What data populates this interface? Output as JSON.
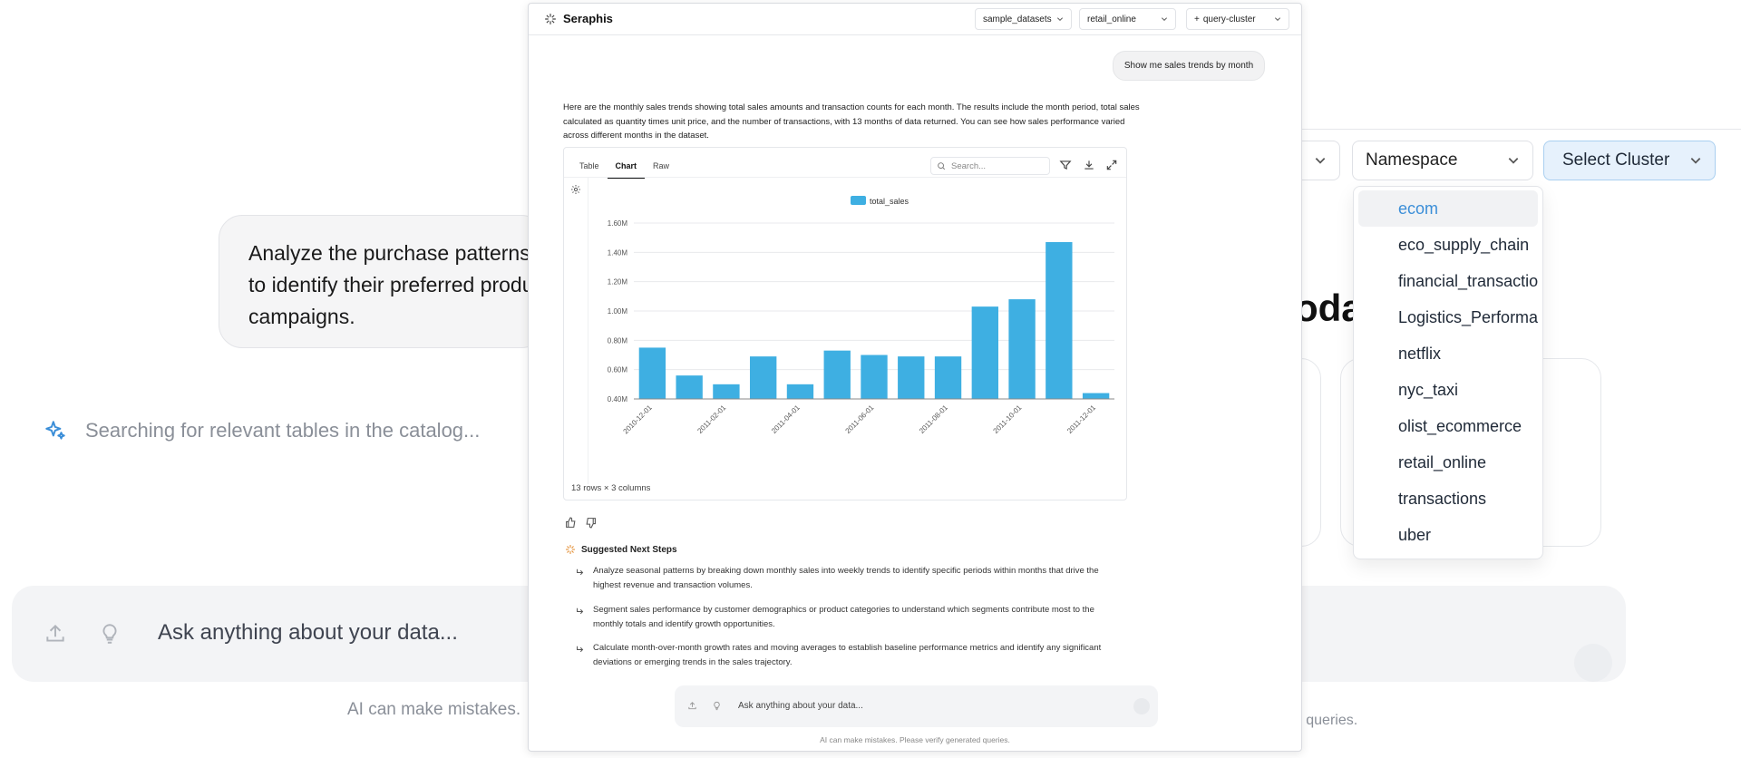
{
  "background": {
    "prompt_bubble_lines": [
      "Analyze the purchase patterns",
      "to identify their preferred produ",
      "campaigns."
    ],
    "searching_text": "Searching for relevant tables in the catalog...",
    "input_placeholder": "Ask anything about your data...",
    "disclaimer_left": "AI can make mistakes.",
    "disclaimer_right": "ed queries.",
    "heading_fragment": "oda",
    "namespace_label": "Namespace",
    "cluster_label": "Select Cluster",
    "dropdown": {
      "selected": "ecom",
      "items": [
        "ecom",
        "eco_supply_chain",
        "financial_transactions",
        "Logistics_Performance",
        "netflix",
        "nyc_taxi",
        "olist_ecommerce",
        "retail_online",
        "transactions",
        "uber"
      ]
    }
  },
  "window": {
    "brand": "Seraphis",
    "selectors": {
      "dataset": "sample_datasets",
      "namespace": "retail_online",
      "cluster": "query-cluster"
    },
    "user_message": "Show me sales trends by month",
    "answer": "Here are the monthly sales trends showing total sales amounts and transaction counts for each month. The results include the month period, total sales calculated as quantity times unit price, and the number of transactions, with 13 months of data returned. You can see how sales performance varied across different months in the dataset.",
    "result": {
      "tabs": [
        "Table",
        "Chart",
        "Raw"
      ],
      "active_tab": "Chart",
      "search_placeholder": "Search...",
      "footer": "13 rows × 3 columns"
    },
    "next_steps_title": "Suggested Next Steps",
    "next_steps": [
      "Analyze seasonal patterns by breaking down monthly sales into weekly trends to identify specific periods within months that drive the highest revenue and transaction volumes.",
      "Segment sales performance by customer demographics or product categories to understand which segments contribute most to the monthly totals and identify growth opportunities.",
      "Calculate month-over-month growth rates and moving averages to establish baseline performance metrics and identify any significant deviations or emerging trends in the sales trajectory."
    ],
    "input_placeholder": "Ask anything about your data...",
    "disclaimer": "AI can make mistakes. Please verify generated queries."
  },
  "colors": {
    "bar": "#3eafe2",
    "accent": "#3b8ed8"
  },
  "chart_data": {
    "type": "bar",
    "series_name": "total_sales",
    "x": [
      "2010-12-01",
      "2011-01-01",
      "2011-02-01",
      "2011-03-01",
      "2011-04-01",
      "2011-05-01",
      "2011-06-01",
      "2011-07-01",
      "2011-08-01",
      "2011-09-01",
      "2011-10-01",
      "2011-11-01",
      "2011-12-01"
    ],
    "x_tick_labels": [
      "2010-12-01",
      "",
      "2011-02-01",
      "",
      "2011-04-01",
      "",
      "2011-06-01",
      "",
      "2011-08-01",
      "",
      "2011-10-01",
      "",
      "2011-12-01"
    ],
    "values": [
      750000,
      560000,
      500000,
      690000,
      500000,
      730000,
      700000,
      690000,
      690000,
      1030000,
      1080000,
      1470000,
      440000
    ],
    "ylim": [
      400000,
      1600000
    ],
    "yticks": [
      400000,
      600000,
      800000,
      1000000,
      1200000,
      1400000,
      1600000
    ],
    "ytick_labels": [
      "0.40M",
      "0.60M",
      "0.80M",
      "1.00M",
      "1.20M",
      "1.40M",
      "1.60M"
    ],
    "legend": "top-center",
    "grid": true
  }
}
